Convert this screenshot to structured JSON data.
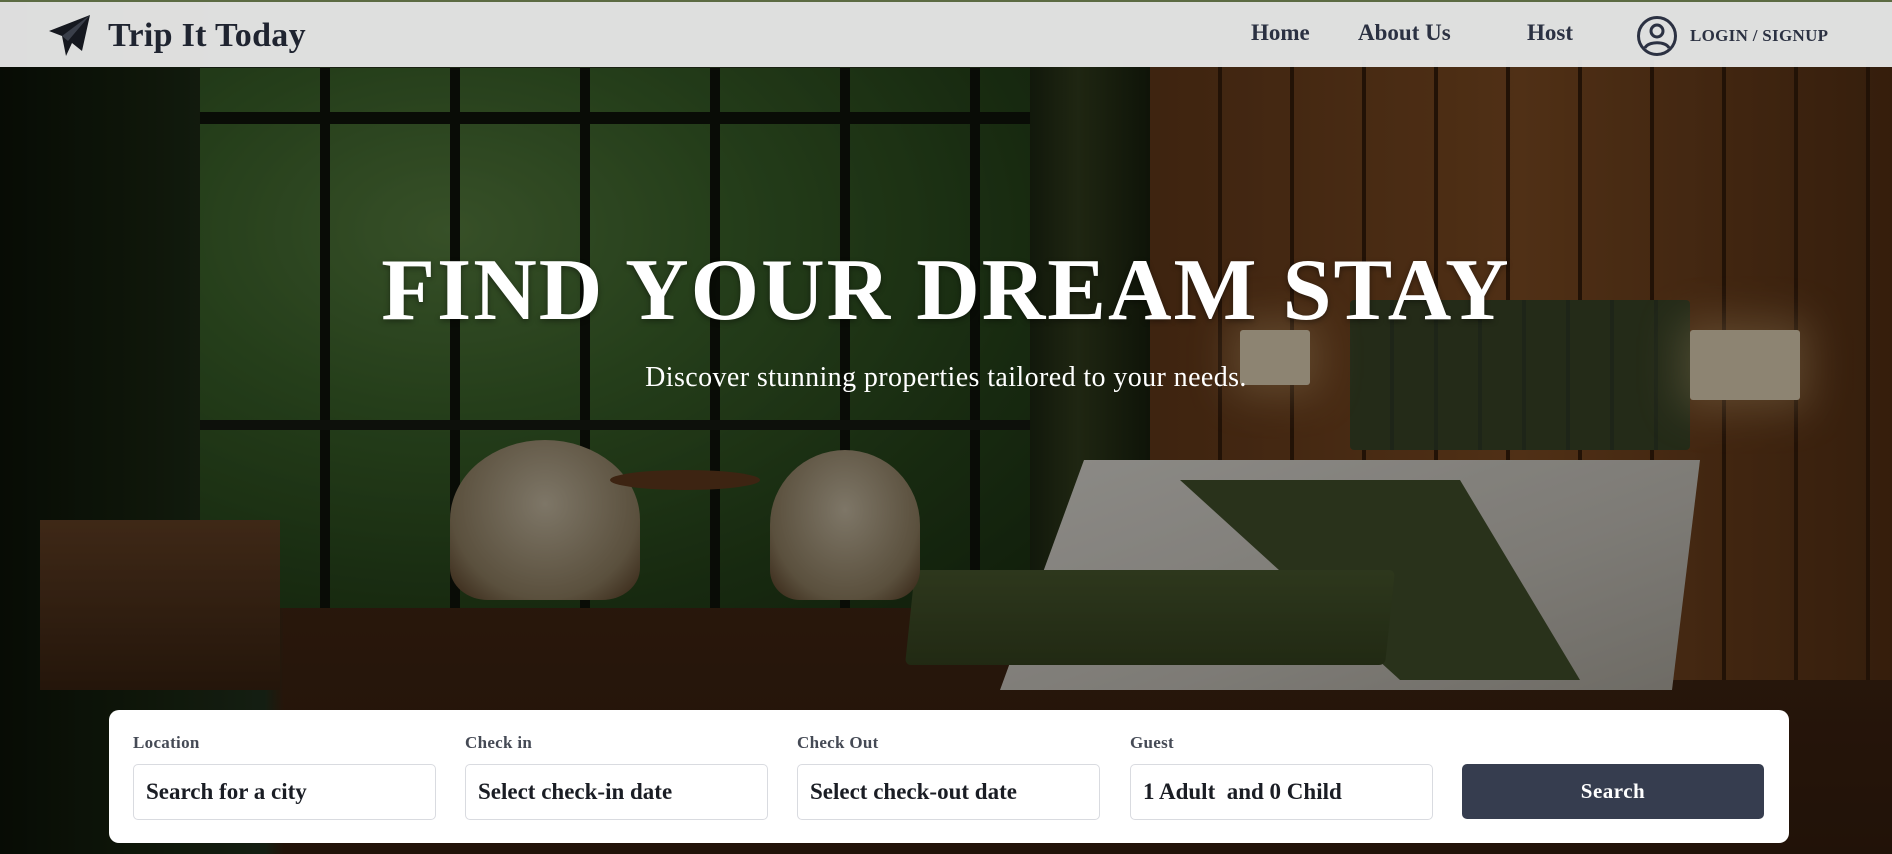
{
  "brand": {
    "name": "Trip It Today",
    "icon": "paper-plane-icon"
  },
  "nav": {
    "items": [
      {
        "label": "Home"
      },
      {
        "label": "About Us"
      },
      {
        "label": "Host"
      }
    ],
    "login": {
      "label": "LOGIN / SIGNUP",
      "icon": "user-circle-icon"
    }
  },
  "hero": {
    "title": "FIND YOUR DREAM STAY",
    "subtitle": "Discover stunning properties tailored to your needs."
  },
  "search": {
    "location": {
      "label": "Location",
      "placeholder": "Search for a city"
    },
    "check_in": {
      "label": "Check in",
      "placeholder": "Select check-in date"
    },
    "check_out": {
      "label": "Check Out",
      "placeholder": "Select check-out date"
    },
    "guest": {
      "label": "Guest",
      "value": "1 Adult  and 0 Child"
    },
    "button_label": "Search"
  },
  "colors": {
    "navbar_bg": "#eeeeee",
    "text_dark": "#2b3142",
    "search_button": "#363d4f",
    "panel_bg": "#ffffff"
  }
}
